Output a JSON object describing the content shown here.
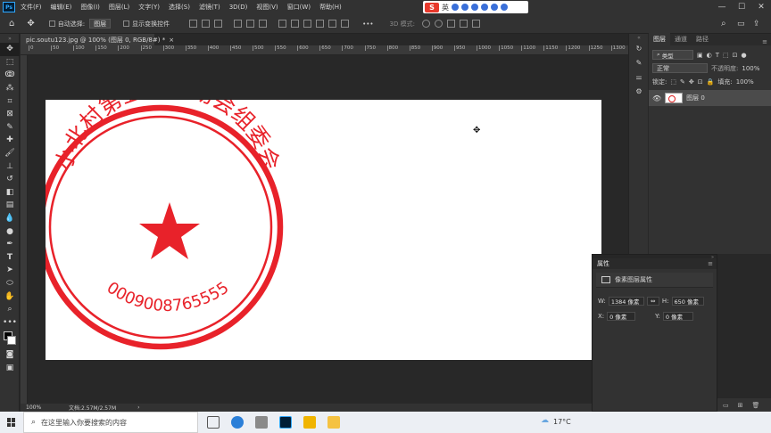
{
  "app": {
    "logo": "Ps"
  },
  "menu": [
    "文件(F)",
    "编辑(E)",
    "图像(I)",
    "图层(L)",
    "文字(Y)",
    "选择(S)",
    "滤镜(T)",
    "3D(D)",
    "视图(V)",
    "窗口(W)",
    "帮助(H)"
  ],
  "window_controls": {
    "minimize": "—",
    "maximize": "☐",
    "close": "✕"
  },
  "ime": {
    "lang": "英",
    "logo": "S"
  },
  "options": {
    "auto_select_label": "自动选择:",
    "auto_select_value": "图层",
    "show_transform_label": "显示变换控件",
    "mode_3d_label": "3D 模式:",
    "more": "•••"
  },
  "document": {
    "tab_title": "pic.soutu123.jpg @ 100% (图层 0, RGB/8#) *",
    "close": "×",
    "ruler_ticks": [
      "0",
      "50",
      "100",
      "150",
      "200",
      "250",
      "300",
      "350",
      "400",
      "450",
      "500",
      "550",
      "600",
      "650",
      "700",
      "750",
      "800",
      "850",
      "900",
      "950",
      "1000",
      "1050",
      "1100",
      "1150",
      "1200",
      "1250",
      "1300"
    ],
    "zoom": "100%",
    "doc_info": "文档:2.57M/2.57M",
    "stamp": {
      "outer_text": "小北村第五节运动会组委会",
      "inner_number": "0009008765555",
      "color": "#e8222a"
    }
  },
  "layers_panel": {
    "tabs": [
      "图层",
      "通道",
      "路径"
    ],
    "filter_kind": "类型",
    "blend_mode": "正常",
    "opacity_label": "不透明度:",
    "opacity_value": "100%",
    "lock_label": "锁定:",
    "fill_label": "填充:",
    "fill_value": "100%",
    "layer_name": "图层 0"
  },
  "properties_panel": {
    "title": "属性",
    "subtitle": "像素图层属性",
    "w_label": "W:",
    "w_value": "1384 像素",
    "h_label": "H:",
    "h_value": "650 像素",
    "x_label": "X:",
    "x_value": "0 像素",
    "y_label": "Y:",
    "y_value": "0 像素",
    "link_icon": "⇔"
  },
  "taskbar": {
    "search_placeholder": "在这里输入你要搜索的内容",
    "weather": "17°C"
  }
}
